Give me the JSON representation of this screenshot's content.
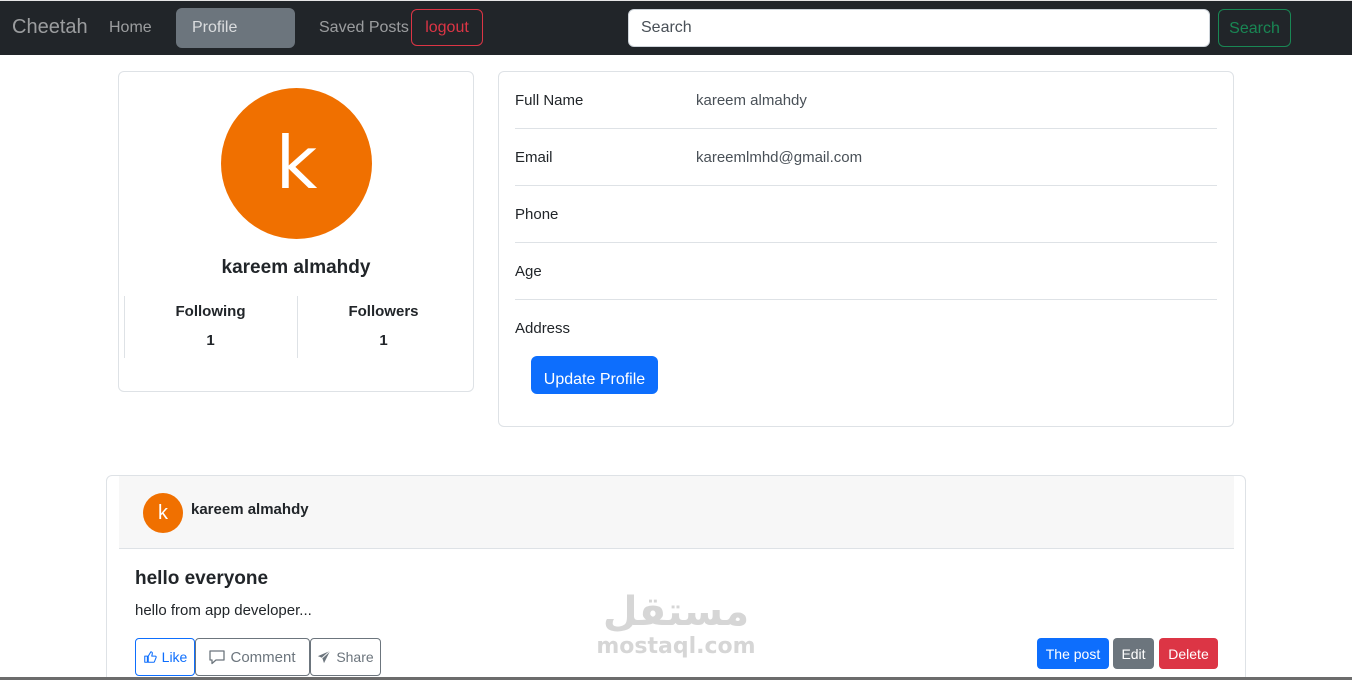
{
  "navbar": {
    "brand": "Cheetah",
    "home": "Home",
    "profile": "Profile",
    "saved_posts": "Saved Posts",
    "logout": "logout",
    "search_placeholder": "Search",
    "search_button": "Search"
  },
  "profile": {
    "avatar_letter": "k",
    "name": "kareem almahdy",
    "following_label": "Following",
    "following_count": "1",
    "followers_label": "Followers",
    "followers_count": "1"
  },
  "details": {
    "rows": [
      {
        "label": "Full Name",
        "value": "kareem almahdy"
      },
      {
        "label": "Email",
        "value": "kareemlmhd@gmail.com"
      },
      {
        "label": "Phone",
        "value": ""
      },
      {
        "label": "Age",
        "value": ""
      },
      {
        "label": "Address",
        "value": ""
      }
    ],
    "update_button": "Update Profile"
  },
  "post": {
    "avatar_letter": "k",
    "author": "kareem almahdy",
    "title": "hello everyone",
    "body": "hello from app developer...",
    "like": "Like",
    "comment": "Comment",
    "share": "Share",
    "the_post": "The post",
    "edit": "Edit",
    "delete": "Delete"
  },
  "watermark": {
    "arabic": "مستقل",
    "latin": "mostaql.com"
  },
  "colors": {
    "navbar_bg": "#212529",
    "avatar": "#f07000",
    "primary": "#0d6efd",
    "secondary": "#6c757d",
    "danger": "#dc3545",
    "success": "#198754"
  }
}
